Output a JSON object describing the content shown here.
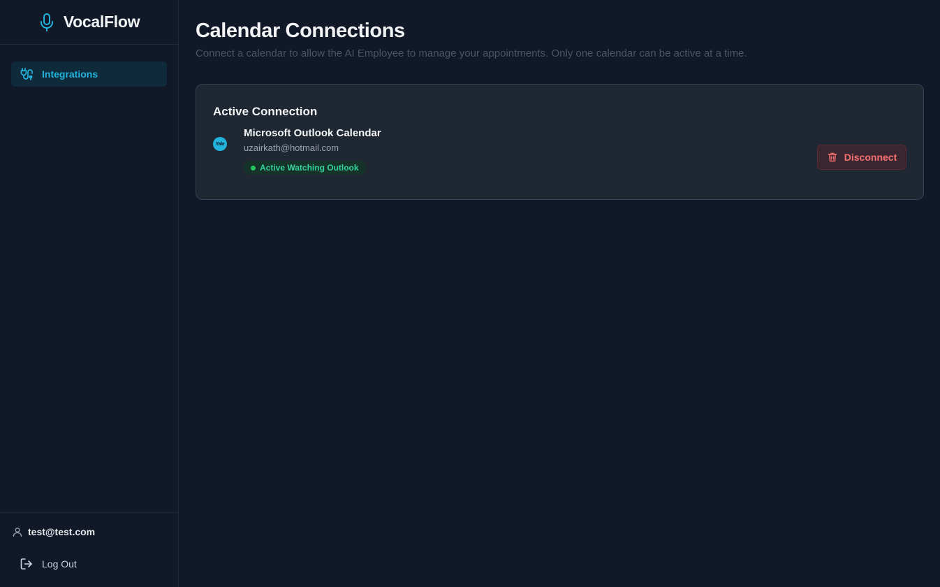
{
  "app": {
    "name": "VocalFlow"
  },
  "sidebar": {
    "items": [
      {
        "label": "Integrations",
        "icon": "integrations-icon",
        "active": true
      }
    ],
    "user": {
      "email": "test@test.com",
      "icon": "user-icon"
    },
    "logout_label": "Log Out"
  },
  "page": {
    "title": "Calendar Connections",
    "subtitle": "Connect a calendar to allow the AI Employee to manage your appointments. Only one calendar can be active at a time."
  },
  "active_connection": {
    "heading": "Active Connection",
    "provider_name": "Microsoft Outlook Calendar",
    "email": "uzairkath@hotmail.com",
    "logo_text": "Yale",
    "status": "Active Watching Outlook",
    "disconnect_label": "Disconnect"
  },
  "colors": {
    "accent": "#22b4dc",
    "background": "#111827",
    "card": "#1f2733",
    "status_green": "#22c55e",
    "danger": "#f87171"
  }
}
